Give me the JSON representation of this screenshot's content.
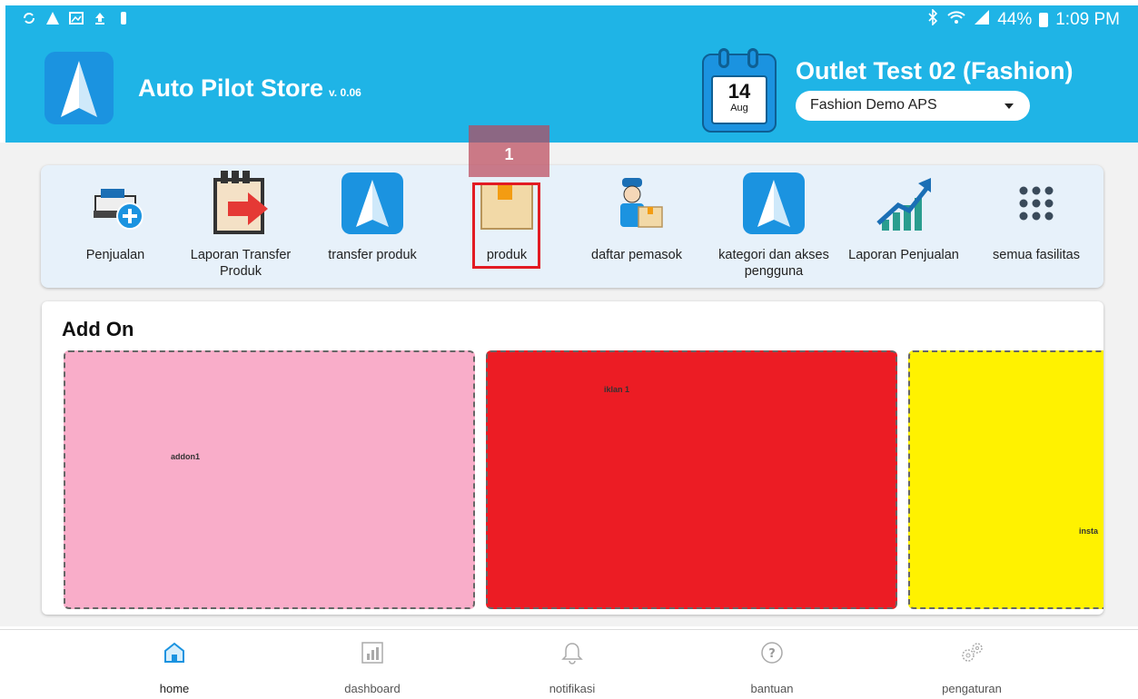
{
  "status_bar": {
    "battery": "44%",
    "time": "1:09 PM"
  },
  "header": {
    "app_title": "Auto Pilot Store",
    "version": "v. 0.06",
    "calendar_day": "14",
    "calendar_month": "Aug",
    "outlet_title": "Outlet Test 02 (Fashion)",
    "outlet_selected": "Fashion Demo APS"
  },
  "annotation": {
    "badge": "1"
  },
  "menu": {
    "items": [
      {
        "label": "Penjualan"
      },
      {
        "label": "Laporan Transfer Produk"
      },
      {
        "label": "transfer produk"
      },
      {
        "label": "produk"
      },
      {
        "label": "daftar pemasok"
      },
      {
        "label": "kategori dan akses pengguna"
      },
      {
        "label": "Laporan Penjualan"
      },
      {
        "label": "semua fasilitas"
      }
    ]
  },
  "addon": {
    "title": "Add On",
    "tiles": [
      {
        "text": "addon1",
        "color": "#f9adc9"
      },
      {
        "text": "iklan 1",
        "color": "#ec1c24"
      },
      {
        "text": "insta",
        "color": "#fff200"
      }
    ]
  },
  "bottom_nav": {
    "items": [
      {
        "label": "home"
      },
      {
        "label": "dashboard"
      },
      {
        "label": "notifikasi"
      },
      {
        "label": "bantuan"
      },
      {
        "label": "pengaturan"
      }
    ]
  },
  "colors": {
    "header": "#1fb4e6",
    "highlight": "#e21b23"
  }
}
